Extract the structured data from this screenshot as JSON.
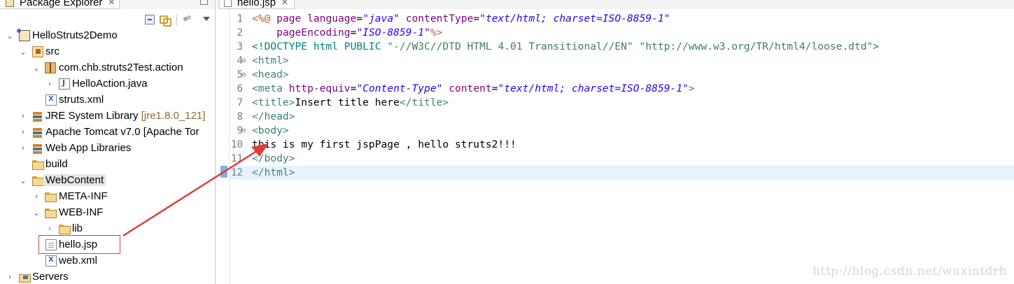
{
  "explorer": {
    "tab_title": "Package Explorer",
    "tab_close": "✕",
    "toolbar": {
      "collapse_all": "collapse-all-icon",
      "link_with_editor": "link-with-editor-icon",
      "filter": "filter-icon",
      "view_menu": "view-menu-icon"
    },
    "tree": [
      {
        "label": "HelloStruts2Demo",
        "icon": "project-icon",
        "twisty": "expanded"
      },
      {
        "label": "src",
        "icon": "source-folder-icon",
        "twisty": "expanded"
      },
      {
        "label": "com.chb.struts2Test.action",
        "icon": "package-icon",
        "twisty": "expanded"
      },
      {
        "label": "HelloAction.java",
        "icon": "java-file-icon",
        "twisty": "collapsed"
      },
      {
        "label": "struts.xml",
        "icon": "xml-file-icon",
        "twisty": ""
      },
      {
        "label": "JRE System Library",
        "decoration": "[jre1.8.0_121]",
        "icon": "library-icon",
        "twisty": "collapsed"
      },
      {
        "label": "Apache Tomcat v7.0 [Apache Tor",
        "icon": "library-icon",
        "twisty": "collapsed"
      },
      {
        "label": "Web App Libraries",
        "icon": "library-icon",
        "twisty": "collapsed"
      },
      {
        "label": "build",
        "icon": "folder-icon",
        "twisty": ""
      },
      {
        "label": "WebContent",
        "icon": "folder-icon",
        "twisty": "expanded"
      },
      {
        "label": "META-INF",
        "icon": "folder-icon",
        "twisty": "collapsed"
      },
      {
        "label": "WEB-INF",
        "icon": "folder-icon",
        "twisty": "expanded"
      },
      {
        "label": "lib",
        "icon": "folder-icon",
        "twisty": "collapsed"
      },
      {
        "label": "hello.jsp",
        "icon": "jsp-file-icon",
        "twisty": ""
      },
      {
        "label": "web.xml",
        "icon": "xml-file-icon",
        "twisty": ""
      },
      {
        "label": "Servers",
        "icon": "servers-folder-icon",
        "twisty": "collapsed"
      }
    ]
  },
  "editor": {
    "tab_title": "hello.jsp",
    "tab_close": "✕",
    "line_numbers": [
      "1",
      "2",
      "3",
      "4",
      "5",
      "6",
      "7",
      "8",
      "9",
      "10",
      "11",
      "12"
    ],
    "fold_markers": [
      "4⊖",
      "5⊖",
      "9⊖"
    ],
    "lines": [
      [
        {
          "c": "t-dir",
          "t": "<%@ "
        },
        {
          "c": "t-att",
          "t": "page "
        },
        {
          "c": "t-att",
          "t": "language"
        },
        {
          "c": "t-txt",
          "t": "="
        },
        {
          "c": "t-str",
          "t": "\"java\""
        },
        {
          "c": "t-txt",
          "t": " "
        },
        {
          "c": "t-att",
          "t": "contentType"
        },
        {
          "c": "t-txt",
          "t": "="
        },
        {
          "c": "t-str",
          "t": "\"text/html; charset=ISO-8859-1\""
        }
      ],
      [
        {
          "c": "t-txt",
          "t": "    "
        },
        {
          "c": "t-att",
          "t": "pageEncoding"
        },
        {
          "c": "t-txt",
          "t": "="
        },
        {
          "c": "t-str",
          "t": "\"ISO-8859-1\""
        },
        {
          "c": "t-dir",
          "t": "%>"
        }
      ],
      [
        {
          "c": "t-doc",
          "t": "<!DOCTYPE html PUBLIC "
        },
        {
          "c": "t-docstr",
          "t": "\"-//W3C//DTD HTML 4.01 Transitional//EN\""
        },
        {
          "c": "t-txt",
          "t": " "
        },
        {
          "c": "t-docstr",
          "t": "\"http://www.w3.org/TR/html4/loose.dtd\""
        },
        {
          "c": "t-doc",
          "t": ">"
        }
      ],
      [
        {
          "c": "t-tag",
          "t": "<html>"
        }
      ],
      [
        {
          "c": "t-tag",
          "t": "<head>"
        }
      ],
      [
        {
          "c": "t-tag",
          "t": "<meta "
        },
        {
          "c": "t-att",
          "t": "http-equiv"
        },
        {
          "c": "t-txt",
          "t": "="
        },
        {
          "c": "t-str",
          "t": "\"Content-Type\""
        },
        {
          "c": "t-txt",
          "t": " "
        },
        {
          "c": "t-att",
          "t": "content"
        },
        {
          "c": "t-txt",
          "t": "="
        },
        {
          "c": "t-str",
          "t": "\"text/html; charset=ISO-8859-1\""
        },
        {
          "c": "t-tag",
          "t": ">"
        }
      ],
      [
        {
          "c": "t-tag",
          "t": "<title>"
        },
        {
          "c": "t-txt",
          "t": "Insert title here"
        },
        {
          "c": "t-tag",
          "t": "</title>"
        }
      ],
      [
        {
          "c": "t-tag",
          "t": "</head>"
        }
      ],
      [
        {
          "c": "t-tag",
          "t": "<body>"
        }
      ],
      [
        {
          "c": "t-txt",
          "t": "this is my first jspPage , hello struts2!!!"
        }
      ],
      [
        {
          "c": "t-tag",
          "t": "</body>"
        }
      ],
      [
        {
          "c": "t-tag",
          "t": "</html>"
        }
      ]
    ],
    "current_line": "12"
  },
  "annotation": {
    "highlight_box_color": "#e03b3b",
    "arrow_color": "#e03b3b"
  },
  "watermark": "http://blog.csdn.net/wuxintdrh"
}
